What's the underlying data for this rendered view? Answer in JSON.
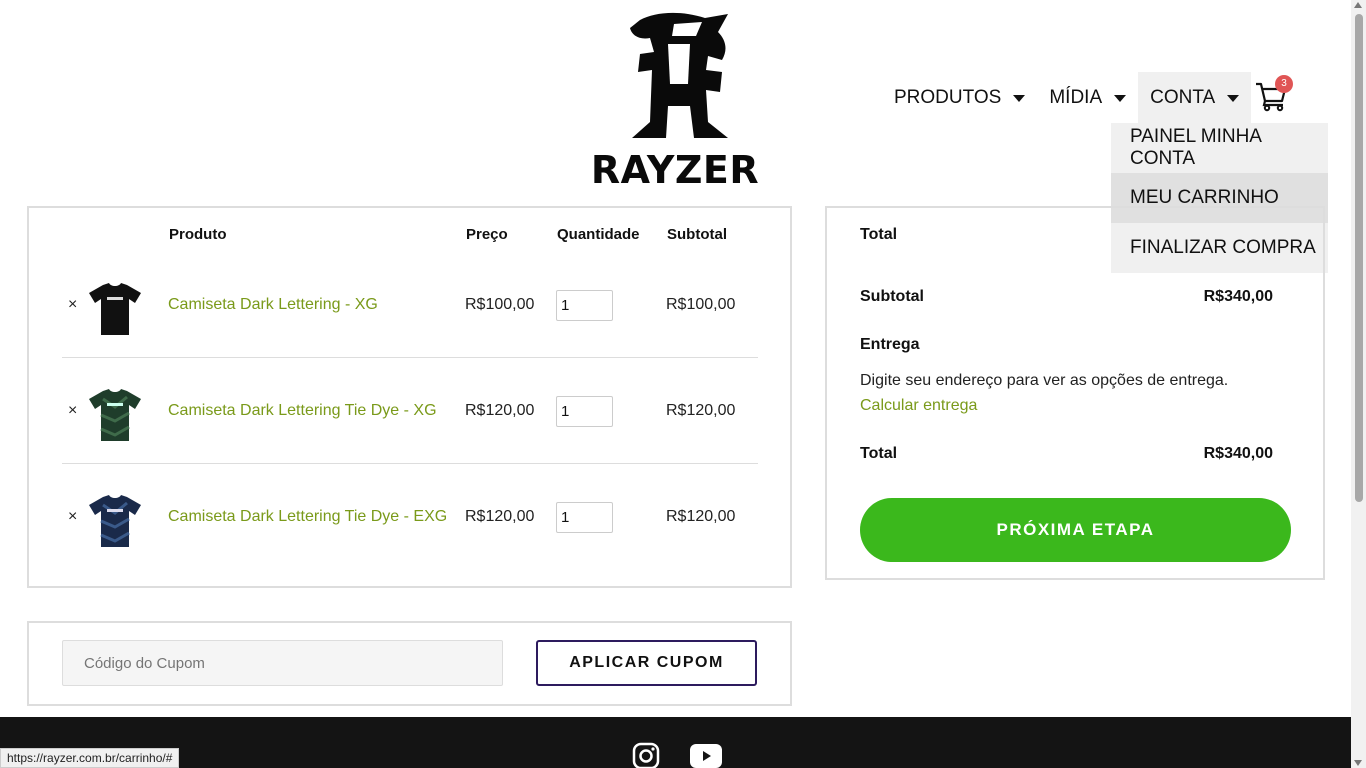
{
  "brand": {
    "name": "RAYZER"
  },
  "nav": {
    "items": [
      {
        "label": "PRODUTOS"
      },
      {
        "label": "MÍDIA"
      },
      {
        "label": "CONTA"
      }
    ],
    "cart_count": "3"
  },
  "dropdown": {
    "items": [
      {
        "label": "PAINEL MINHA CONTA"
      },
      {
        "label": "MEU CARRINHO"
      },
      {
        "label": "FINALIZAR COMPRA"
      }
    ]
  },
  "cart": {
    "headers": {
      "product": "Produto",
      "price": "Preço",
      "quantity": "Quantidade",
      "subtotal": "Subtotal"
    },
    "remove_symbol": "×",
    "rows": [
      {
        "name": "Camiseta Dark Lettering - XG",
        "price": "R$100,00",
        "qty": "1",
        "subtotal": "R$100,00"
      },
      {
        "name": "Camiseta Dark Lettering Tie Dye - XG",
        "price": "R$120,00",
        "qty": "1",
        "subtotal": "R$120,00"
      },
      {
        "name": "Camiseta Dark Lettering Tie Dye - EXG",
        "price": "R$120,00",
        "qty": "1",
        "subtotal": "R$120,00"
      }
    ]
  },
  "coupon": {
    "placeholder": "Código do Cupom",
    "button": "APLICAR CUPOM"
  },
  "totals": {
    "heading": "Total",
    "subtotal_label": "Subtotal",
    "subtotal_value": "R$340,00",
    "shipping_label": "Entrega",
    "shipping_text": "Digite seu endereço para ver as opções de entrega.",
    "shipping_link": "Calcular entrega",
    "total_label": "Total",
    "total_value": "R$340,00",
    "next_button": "PRÓXIMA ETAPA"
  },
  "status_bar": {
    "url": "https://rayzer.com.br/carrinho/#"
  },
  "colors": {
    "accent_green": "#3bb81c",
    "link_green": "#7a9a1a",
    "badge_red": "#e05555",
    "footer": "#141414"
  }
}
